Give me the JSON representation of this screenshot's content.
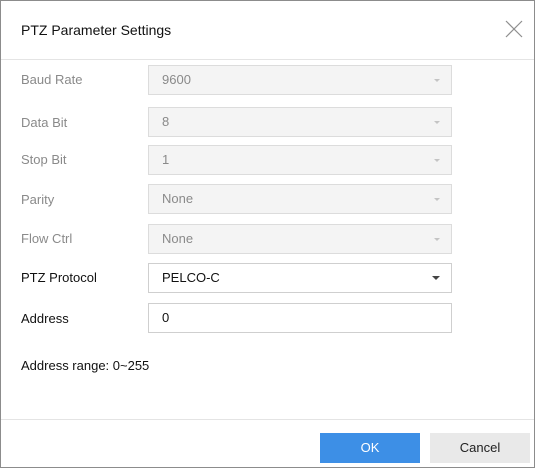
{
  "dialog": {
    "title": "PTZ Parameter Settings"
  },
  "fields": {
    "baud_rate": {
      "label": "Baud Rate",
      "value": "9600"
    },
    "data_bit": {
      "label": "Data Bit",
      "value": "8"
    },
    "stop_bit": {
      "label": "Stop Bit",
      "value": "1"
    },
    "parity": {
      "label": "Parity",
      "value": "None"
    },
    "flow_ctrl": {
      "label": "Flow Ctrl",
      "value": "None"
    },
    "ptz_protocol": {
      "label": "PTZ Protocol",
      "value": "PELCO-C"
    },
    "address": {
      "label": "Address",
      "value": "0"
    }
  },
  "note": "Address range: 0~255",
  "buttons": {
    "ok": "OK",
    "cancel": "Cancel"
  },
  "colors": {
    "primary": "#3d8fe6",
    "disabled_text": "#8a8a8a",
    "disabled_bg": "#f4f4f4"
  }
}
